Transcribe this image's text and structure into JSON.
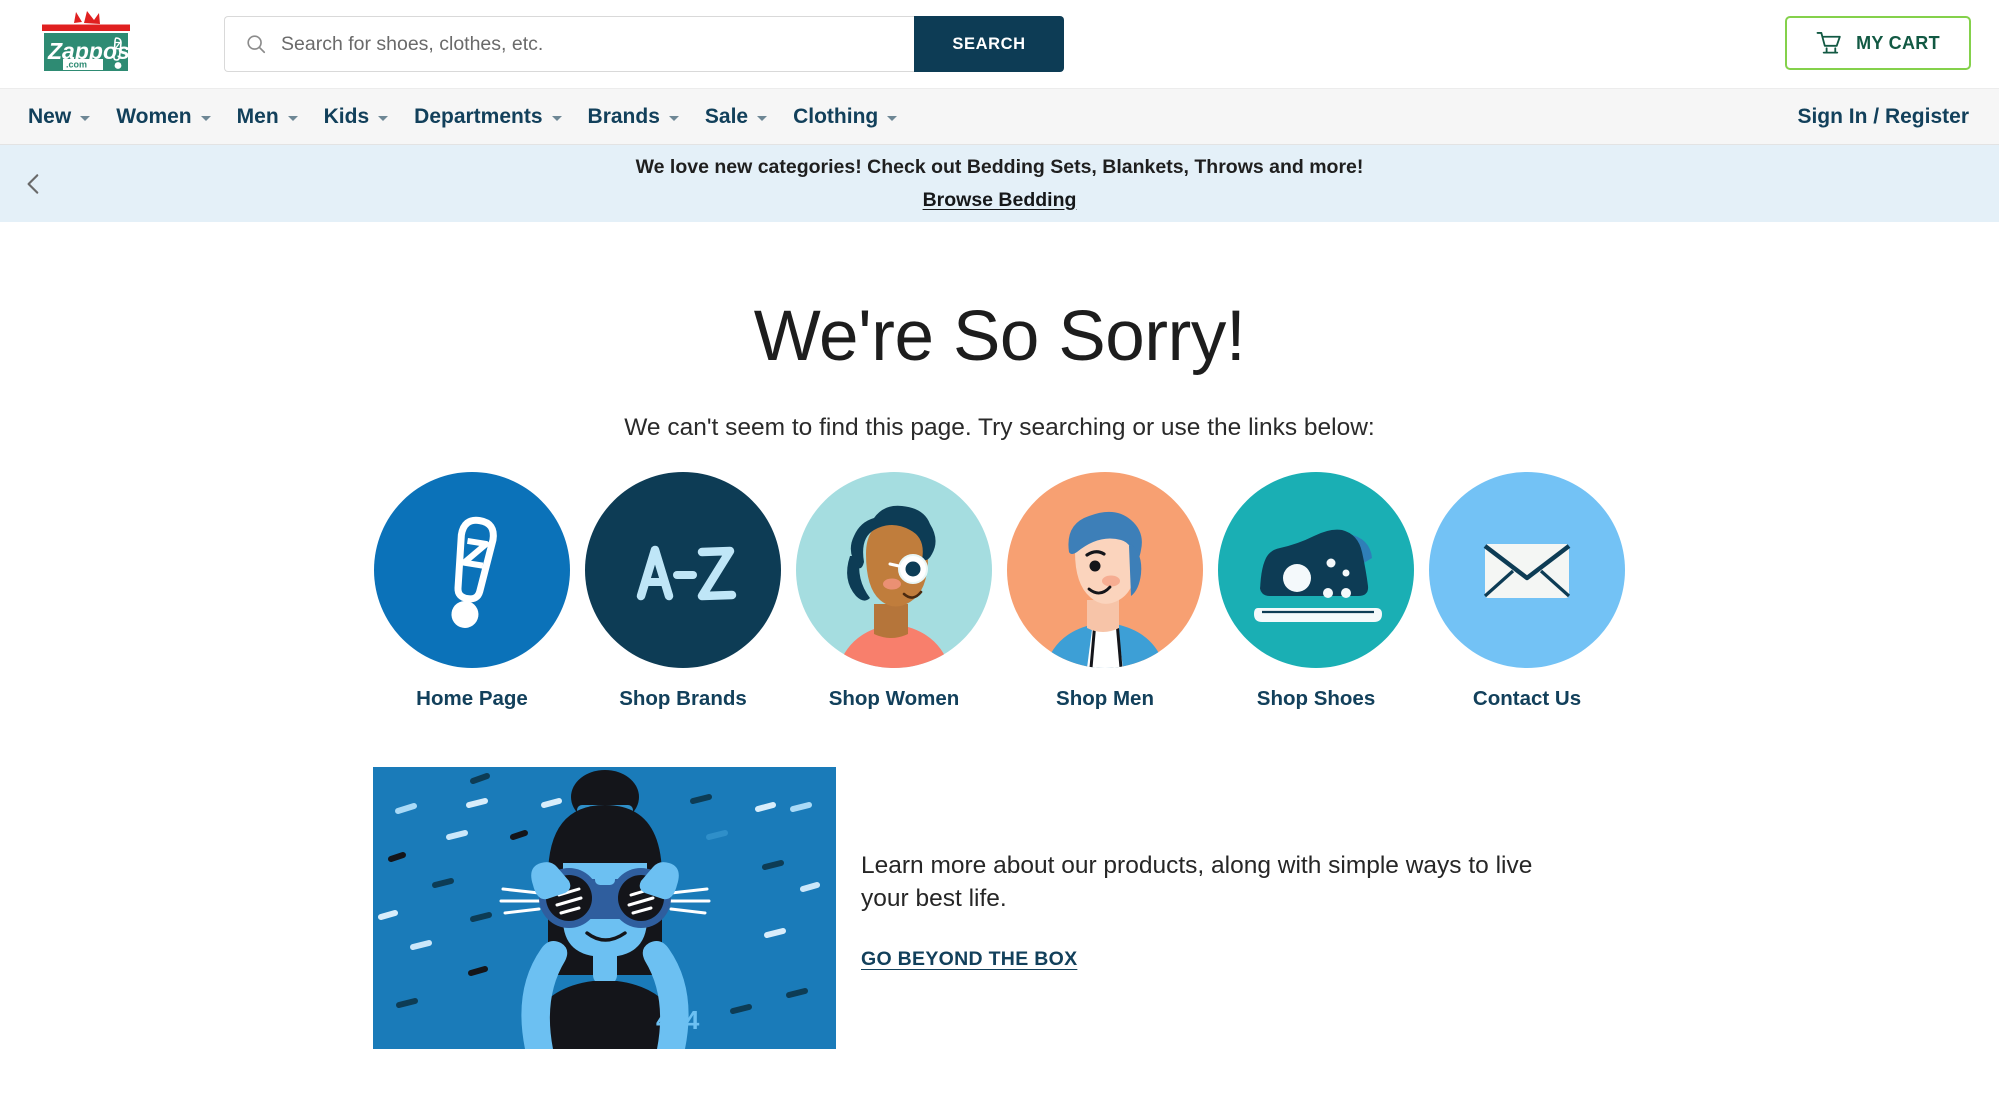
{
  "header": {
    "logo": {
      "name": "zappos-logo",
      "wordmark": "Zappos",
      "suffix": ".com",
      "box_color": "#2e8b73",
      "accent_color": "#e02020"
    },
    "search": {
      "placeholder": "Search for shoes, clothes, etc.",
      "value": "",
      "button_label": "SEARCH",
      "button_color": "#0d3c55",
      "icon": "search-icon"
    },
    "cart": {
      "label": "MY CART",
      "icon": "shopping-cart-icon",
      "border_color": "#84d14b",
      "text_color": "#125943"
    }
  },
  "nav": {
    "items": [
      {
        "label": "New",
        "has_dropdown": true
      },
      {
        "label": "Women",
        "has_dropdown": true
      },
      {
        "label": "Men",
        "has_dropdown": true
      },
      {
        "label": "Kids",
        "has_dropdown": true
      },
      {
        "label": "Departments",
        "has_dropdown": true
      },
      {
        "label": "Brands",
        "has_dropdown": true
      },
      {
        "label": "Sale",
        "has_dropdown": true
      },
      {
        "label": "Clothing",
        "has_dropdown": true
      }
    ],
    "account_label": "Sign In / Register"
  },
  "promo_banner": {
    "prev_icon": "chevron-left-icon",
    "message": "We love new categories! Check out Bedding Sets, Blankets, Throws and more!",
    "link_label": "Browse Bedding",
    "background": "#e4f0f8"
  },
  "main": {
    "title": "We're So Sorry!",
    "subtitle": "We can't seem to find this page. Try searching or use the links below:",
    "links": [
      {
        "label": "Home Page",
        "icon": "zappos-exclamation-icon",
        "circle_color": "#0b72b9"
      },
      {
        "label": "Shop Brands",
        "icon": "a-to-z-icon",
        "circle_color": "#0d3c55"
      },
      {
        "label": "Shop Women",
        "icon": "woman-avatar-icon",
        "circle_color": "#a5dde0"
      },
      {
        "label": "Shop Men",
        "icon": "man-avatar-icon",
        "circle_color": "#f7a072"
      },
      {
        "label": "Shop Shoes",
        "icon": "sneaker-icon",
        "circle_color": "#1aafb4"
      },
      {
        "label": "Contact Us",
        "icon": "envelope-icon",
        "circle_color": "#73c2f5"
      }
    ]
  },
  "bottom_promo": {
    "image": {
      "name": "404-binoculars-illustration",
      "shirt_text": "404",
      "background": "#1a7bb9"
    },
    "text": "Learn more about our products, along with simple ways to live your best life.",
    "cta_label": "GO BEYOND THE BOX"
  }
}
